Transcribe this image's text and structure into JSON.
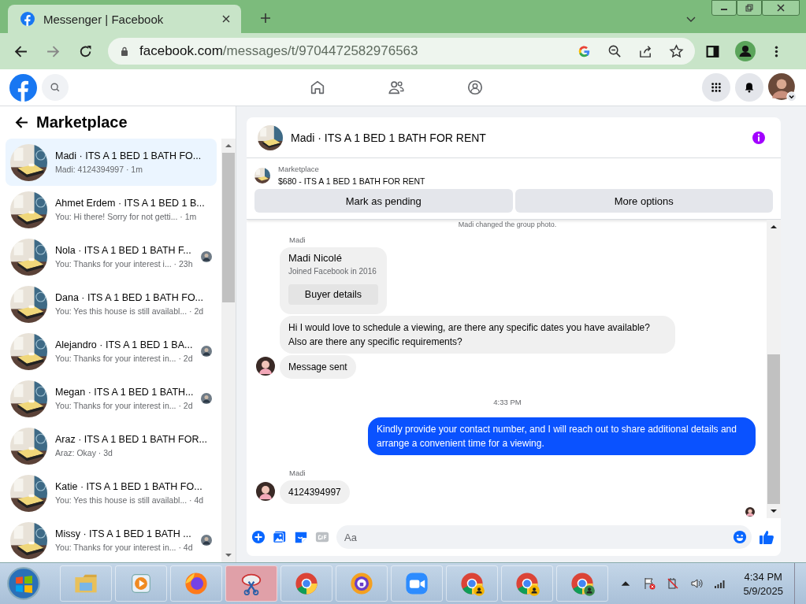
{
  "browser": {
    "tab_title": "Messenger | Facebook",
    "url_domain": "facebook.com",
    "url_path": "/messages/t/9704472582976563"
  },
  "sidebar": {
    "title": "Marketplace",
    "conversations": [
      {
        "title": "Madi · ITS A 1 BED 1 BATH FO...",
        "preview": "Madi: 4124394997 · 1m",
        "selected": true,
        "seen": false
      },
      {
        "title": "Ahmet Erdem · ITS A 1 BED 1 B...",
        "preview": "You: Hi there! Sorry for not getti... · 1m",
        "selected": false,
        "seen": false
      },
      {
        "title": "Nola · ITS A 1 BED 1 BATH F...",
        "preview": "You: Thanks for your interest i... · 23h",
        "selected": false,
        "seen": true
      },
      {
        "title": "Dana · ITS A 1 BED 1 BATH FO...",
        "preview": "You: Yes this house is still availabl... · 2d",
        "selected": false,
        "seen": false
      },
      {
        "title": "Alejandro · ITS A 1 BED 1 BA...",
        "preview": "You: Thanks for your interest in... · 2d",
        "selected": false,
        "seen": true
      },
      {
        "title": "Megan · ITS A 1 BED 1 BATH...",
        "preview": "You: Thanks for your interest in... · 2d",
        "selected": false,
        "seen": true
      },
      {
        "title": "Araz · ITS A 1 BED 1 BATH FOR...",
        "preview": "Araz: Okay · 3d",
        "selected": false,
        "seen": false
      },
      {
        "title": "Katie · ITS A 1 BED 1 BATH FO...",
        "preview": "You: Yes this house is still availabl... · 4d",
        "selected": false,
        "seen": false
      },
      {
        "title": "Missy · ITS A 1 BED 1 BATH ...",
        "preview": "You: Thanks for your interest in... · 4d",
        "selected": false,
        "seen": true
      }
    ]
  },
  "chat": {
    "title": "Madi · ITS A 1 BED 1 BATH FOR RENT",
    "listing": {
      "label": "Marketplace",
      "title": "$680 - ITS A 1 BED 1 BATH FOR RENT"
    },
    "actions": [
      "Mark as pending",
      "More options"
    ],
    "messages": [
      {
        "kind": "system",
        "text": "Madi changed the group photo."
      },
      {
        "kind": "sender",
        "text": "Madi"
      },
      {
        "kind": "card",
        "name": "Madi Nicolé",
        "subtitle": "Joined Facebook in 2016",
        "button": "Buyer details"
      },
      {
        "kind": "incoming",
        "text": "Hi I would love to schedule a viewing, are there any specific dates you have available? Also are there any specific requirements?",
        "avatar": false
      },
      {
        "kind": "incoming",
        "text": "Message sent",
        "avatar": true
      },
      {
        "kind": "time",
        "text": "4:33 PM"
      },
      {
        "kind": "outgoing",
        "text": "Kindly provide your contact number, and I will reach out to share additional details and arrange a convenient time for a viewing."
      },
      {
        "kind": "sender",
        "text": "Madi"
      },
      {
        "kind": "incoming",
        "text": "4124394997",
        "avatar": true
      }
    ],
    "composer": {
      "placeholder": "Aa"
    }
  },
  "taskbar": {
    "time": "4:34 PM",
    "date": "5/9/2025"
  }
}
